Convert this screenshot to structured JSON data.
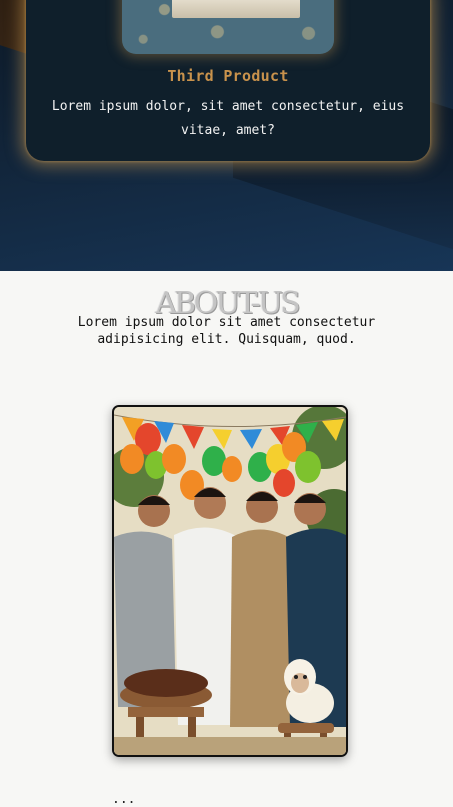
{
  "product": {
    "title": "Third Product",
    "description": "Lorem ipsum dolor, sit amet consectetur, eius vitae, amet?",
    "image_icon": "product-image"
  },
  "about": {
    "title": "ABOUT-US",
    "text": "Lorem ipsum dolor sit amet consectetur adipisicing elit. Quisquam, quod.",
    "image_icon": "group-photo"
  },
  "footer_peek": {
    "text": "..."
  },
  "colors": {
    "hero_bg": "#12253a",
    "card_bg": "#0f1f2b",
    "card_glow": "#d6a052",
    "title_gold": "#c8924c",
    "page_bg": "#f7f7f5"
  }
}
